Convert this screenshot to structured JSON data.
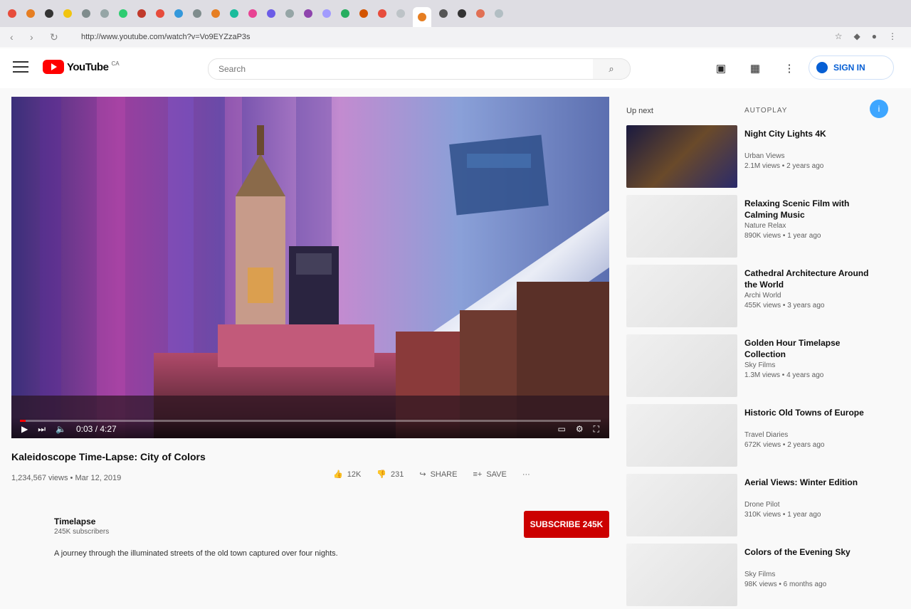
{
  "browser": {
    "url": "http://www.youtube.com/watch?v=Vo9EYZzaP3s",
    "tab_colors": [
      "#e74c3c",
      "#e67e22",
      "#333333",
      "#f1c40f",
      "#7f8c8d",
      "#95a5a6",
      "#2ecc71",
      "#c0392b",
      "#e74c3c",
      "#3498db",
      "#7f8c8d",
      "#e67e22",
      "#1abc9c",
      "#e84393",
      "#6c5ce7",
      "#95a5a6",
      "#8e44ad",
      "#a29bfe",
      "#27ae60",
      "#d35400",
      "#e74c3c",
      "#bdc3c7",
      "#e67e22",
      "#555555",
      "#333333",
      "#e17055",
      "#b2bec3"
    ]
  },
  "header": {
    "logo_word": "YouTube",
    "logo_cc": "CA",
    "search_placeholder": "Search",
    "signin_label": "SIGN IN"
  },
  "video": {
    "title": "Kaleidoscope Time-Lapse: City of Colors",
    "meta": "1,234,567 views • Mar 12, 2019",
    "time": "0:03 / 4:27",
    "likes": "12K",
    "dislikes": "231",
    "share_label": "SHARE",
    "save_label": "SAVE",
    "progress_percent": 1
  },
  "channel": {
    "name": "Timelapse",
    "subs": "245K subscribers",
    "subscribe_label": "SUBSCRIBE 245K",
    "description": "A journey through the illuminated streets of the old town captured over four nights."
  },
  "sidebar": {
    "up_next": "Up next",
    "autoplay": "AUTOPLAY",
    "recs": [
      {
        "title": "Night City Lights 4K",
        "channel": "Urban Views",
        "views": "2.1M views • 2 years ago"
      },
      {
        "title": "Relaxing Scenic Film with Calming Music",
        "channel": "Nature Relax",
        "views": "890K views • 1 year ago"
      },
      {
        "title": "Cathedral Architecture Around the World",
        "channel": "Archi World",
        "views": "455K views • 3 years ago"
      },
      {
        "title": "Golden Hour Timelapse Collection",
        "channel": "Sky Films",
        "views": "1.3M views • 4 years ago"
      },
      {
        "title": "Historic Old Towns of Europe",
        "channel": "Travel Diaries",
        "views": "672K views • 2 years ago"
      },
      {
        "title": "Aerial Views: Winter Edition",
        "channel": "Drone Pilot",
        "views": "310K views • 1 year ago"
      },
      {
        "title": "Colors of the Evening Sky",
        "channel": "Sky Films",
        "views": "98K views • 6 months ago"
      }
    ]
  }
}
